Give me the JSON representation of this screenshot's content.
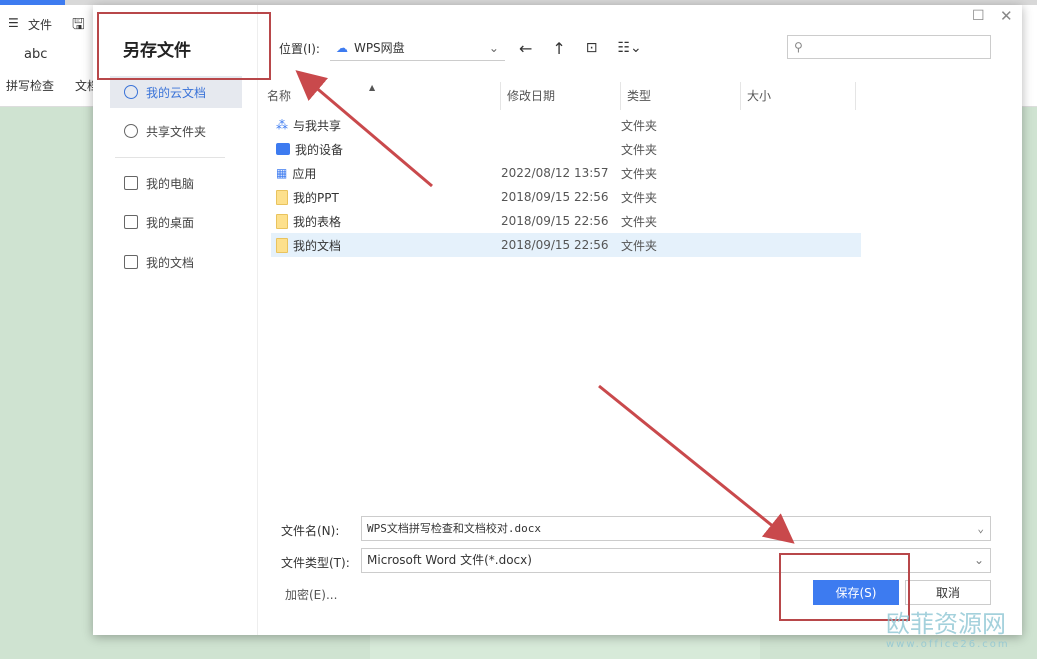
{
  "app": {
    "menu_label": "文件",
    "spell_check": "拼写检查",
    "doc_check_partial": "文档"
  },
  "dialog": {
    "title": "另存文件",
    "sidebar": [
      {
        "label": "我的云文档",
        "icon": "cloud-doc-icon",
        "selected": true
      },
      {
        "label": "共享文件夹",
        "icon": "share-folder-icon"
      },
      {
        "label": "我的电脑",
        "icon": "computer-icon"
      },
      {
        "label": "我的桌面",
        "icon": "desktop-icon"
      },
      {
        "label": "我的文档",
        "icon": "documents-icon"
      }
    ],
    "location_label": "位置(I):",
    "location_value": "WPS网盘",
    "columns": [
      "名称",
      "修改日期",
      "类型",
      "大小"
    ],
    "files": [
      {
        "name": "与我共享",
        "date": "",
        "type": "文件夹",
        "icon": "share-icon"
      },
      {
        "name": "我的设备",
        "date": "",
        "type": "文件夹",
        "icon": "device-icon"
      },
      {
        "name": "应用",
        "date": "2022/08/12 13:57",
        "type": "文件夹",
        "icon": "apps-icon"
      },
      {
        "name": "我的PPT",
        "date": "2018/09/15 22:56",
        "type": "文件夹",
        "icon": "folder-icon"
      },
      {
        "name": "我的表格",
        "date": "2018/09/15 22:56",
        "type": "文件夹",
        "icon": "folder-icon"
      },
      {
        "name": "我的文档",
        "date": "2018/09/15 22:56",
        "type": "文件夹",
        "icon": "folder-icon",
        "selected": true
      }
    ],
    "filename_label": "文件名(N):",
    "filename_value": "WPS文档拼写检查和文档校对.docx",
    "filetype_label": "文件类型(T):",
    "filetype_value": "Microsoft Word 文件(*.docx)",
    "encrypt_label": "加密(E)...",
    "save_label": "保存(S)",
    "cancel_label": "取消"
  },
  "watermark": {
    "text": "欧菲资源网",
    "url": "www.office26.com"
  },
  "colors": {
    "accent": "#3d7bf0",
    "annotation": "#b8474a"
  }
}
